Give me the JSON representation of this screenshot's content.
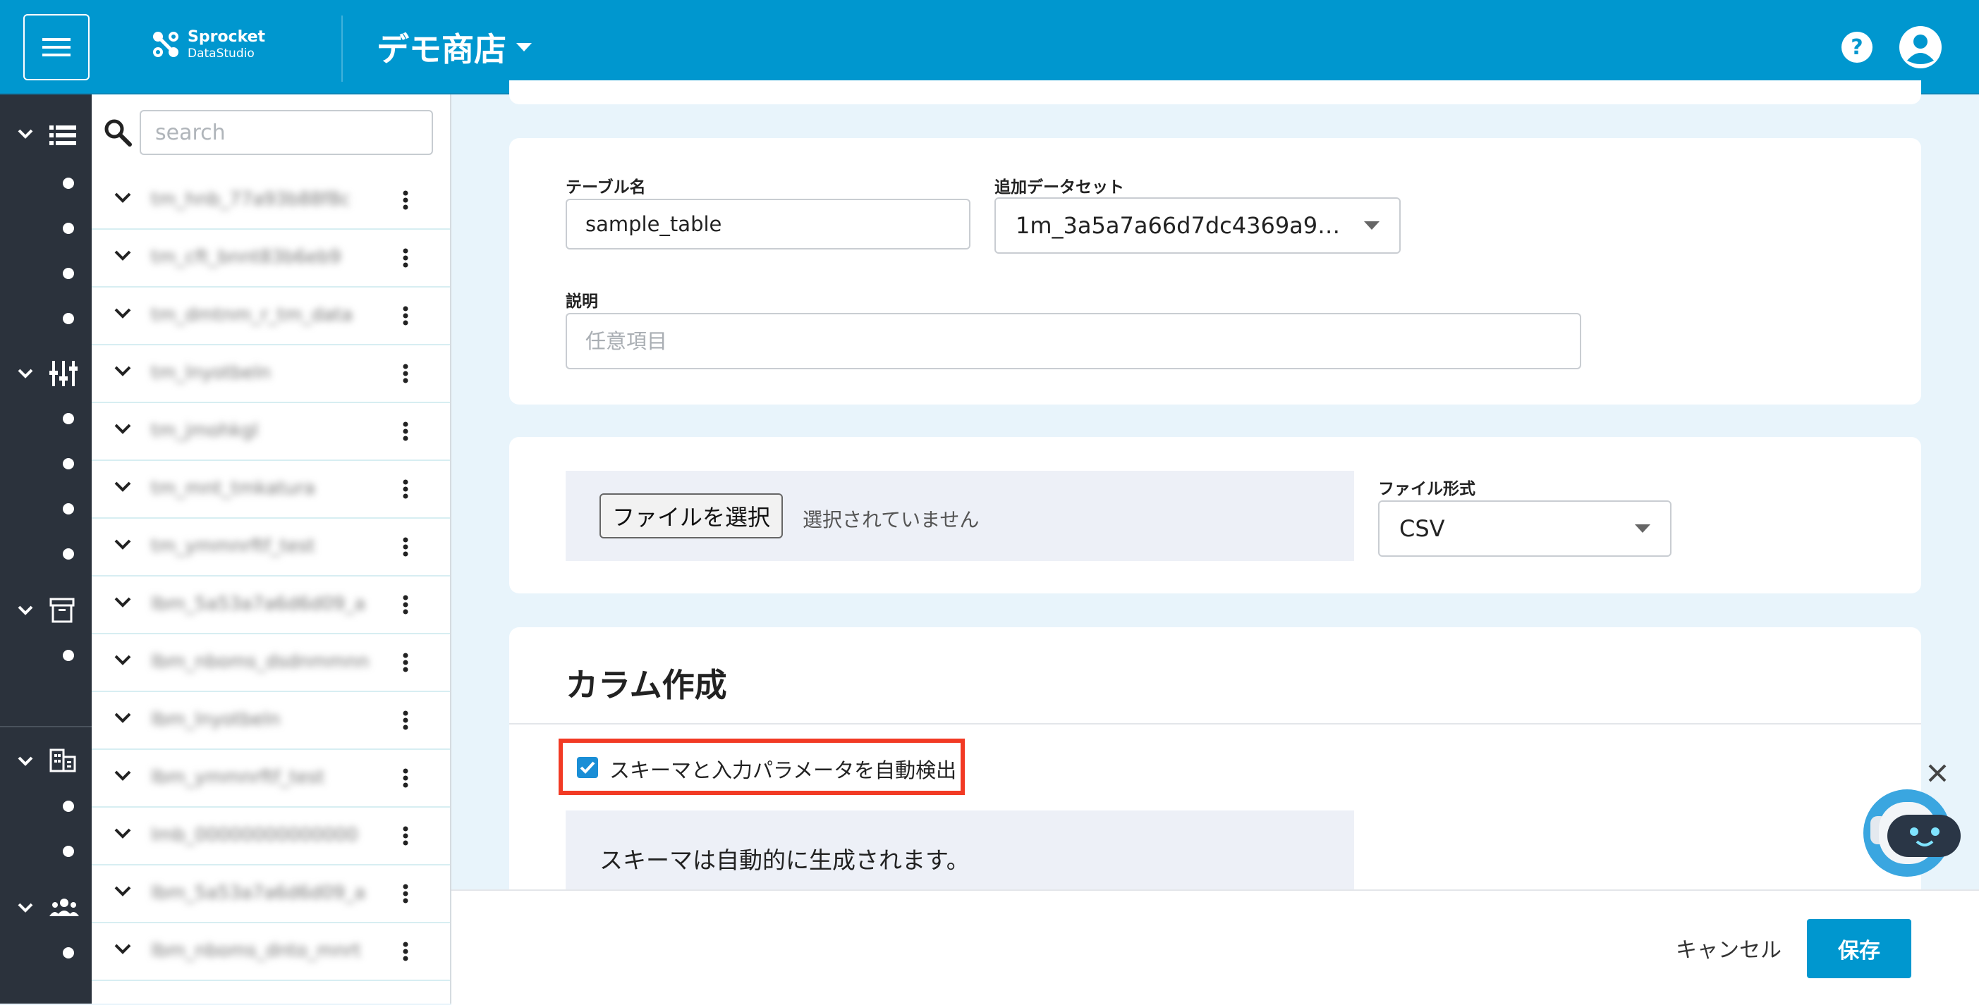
{
  "header": {
    "brand_name": "Sprocket",
    "brand_sub": "DataStudio",
    "store_name": "デモ商店"
  },
  "search": {
    "placeholder": "search"
  },
  "tree": {
    "items": [
      "tm_hnb_77a93b88f8c",
      "tm_cft_bnnt83b6eb9",
      "tm_dmtnm_r_tm_data",
      "tm_lnyotbeln",
      "tm_jmohkgl",
      "tm_mnt_tmkatura",
      "tm_ymmnrftf_test",
      "lbm_5a53a7a6d6d09_a",
      "lbm_nboms_dsdnmmnn",
      "lbm_lnyotbeln",
      "lbm_ymmnrftf_test",
      "lmb_00000000000000",
      "lbm_5a53a7a6d6d09_a",
      "lbm_nboms_dnto_mnrt"
    ]
  },
  "form": {
    "table_name_label": "テーブル名",
    "table_name_value": "sample_table",
    "dataset_label": "追加データセット",
    "dataset_value": "1m_3a5a7a66d7dc4369a9…",
    "description_label": "説明",
    "description_placeholder": "任意項目"
  },
  "file": {
    "choose_button": "ファイルを選択",
    "status": "選択されていません",
    "format_label": "ファイル形式",
    "format_value": "CSV"
  },
  "columns": {
    "title": "カラム作成",
    "auto_detect_label": "スキーマと入力パラメータを自動検出",
    "auto_detect_checked": true,
    "info": "スキーマは自動的に生成されます。"
  },
  "footer": {
    "cancel": "キャンセル",
    "save": "保存"
  },
  "colors": {
    "header": "#0097cf",
    "rail": "#2b323c",
    "highlight": "#f23a24",
    "accent": "#0097cf"
  }
}
